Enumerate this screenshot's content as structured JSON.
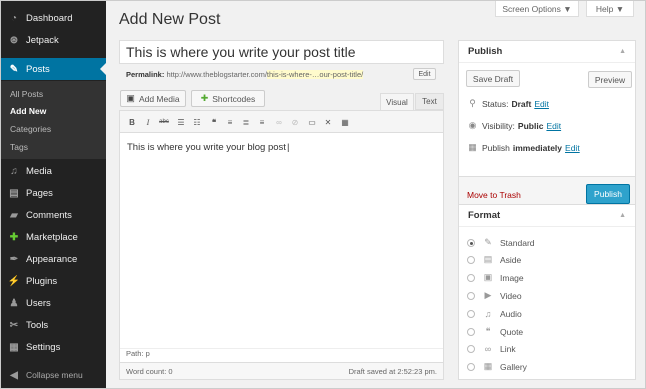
{
  "sidebar": {
    "items": [
      {
        "label": "Dashboard",
        "icon": "dashboard-icon",
        "glyph": "◔"
      },
      {
        "label": "Jetpack",
        "icon": "jetpack-icon",
        "glyph": "⊛"
      },
      {
        "label": "Posts",
        "icon": "pin-icon",
        "glyph": "✎"
      },
      {
        "label": "Media",
        "icon": "media-icon",
        "glyph": "♫"
      },
      {
        "label": "Pages",
        "icon": "pages-icon",
        "glyph": "▤"
      },
      {
        "label": "Comments",
        "icon": "comments-icon",
        "glyph": "▰"
      },
      {
        "label": "Marketplace",
        "icon": "marketplace-icon",
        "glyph": "✚"
      },
      {
        "label": "Appearance",
        "icon": "appearance-icon",
        "glyph": "✒"
      },
      {
        "label": "Plugins",
        "icon": "plugins-icon",
        "glyph": "⚡"
      },
      {
        "label": "Users",
        "icon": "users-icon",
        "glyph": "♟"
      },
      {
        "label": "Tools",
        "icon": "tools-icon",
        "glyph": "✂"
      },
      {
        "label": "Settings",
        "icon": "settings-icon",
        "glyph": "▦"
      }
    ],
    "submenu": [
      "All Posts",
      "Add New",
      "Categories",
      "Tags"
    ],
    "collapse": "Collapse menu"
  },
  "header": {
    "title": "Add New Post",
    "screen_options": "Screen Options ▼",
    "help": "Help ▼"
  },
  "post": {
    "title": "This is where you write your post title",
    "permalink_label": "Permalink:",
    "permalink_base": "http://www.theblogstarter.com/",
    "permalink_slug": "this-is-where-…our-post-title/",
    "edit_label": "Edit"
  },
  "media": {
    "add_media": "Add Media",
    "shortcodes": "Shortcodes"
  },
  "editor": {
    "tab_visual": "Visual",
    "tab_text": "Text",
    "content": "This is where you write your blog post",
    "path": "Path: p",
    "word_count": "Word count: 0",
    "draft_saved": "Draft saved at 2:52:23 pm."
  },
  "publish": {
    "heading": "Publish",
    "save_draft": "Save Draft",
    "preview": "Preview",
    "status_label": "Status:",
    "status_value": "Draft",
    "visibility_label": "Visibility:",
    "visibility_value": "Public",
    "publish_label": "Publish",
    "publish_value": "immediately",
    "edit": "Edit",
    "trash": "Move to Trash",
    "publish_button": "Publish"
  },
  "format": {
    "heading": "Format",
    "options": [
      {
        "label": "Standard",
        "icon": "pin-icon",
        "glyph": "✎",
        "selected": true
      },
      {
        "label": "Aside",
        "icon": "aside-icon",
        "glyph": "▤",
        "selected": false
      },
      {
        "label": "Image",
        "icon": "image-icon",
        "glyph": "▣",
        "selected": false
      },
      {
        "label": "Video",
        "icon": "video-icon",
        "glyph": "▶",
        "selected": false
      },
      {
        "label": "Audio",
        "icon": "audio-icon",
        "glyph": "♫",
        "selected": false
      },
      {
        "label": "Quote",
        "icon": "quote-icon",
        "glyph": "❝",
        "selected": false
      },
      {
        "label": "Link",
        "icon": "link-icon",
        "glyph": "∞",
        "selected": false
      },
      {
        "label": "Gallery",
        "icon": "gallery-icon",
        "glyph": "▦",
        "selected": false
      }
    ]
  },
  "colors": {
    "sidebar_bg": "#222222",
    "active": "#0074a2",
    "publish_button": "#2ea2cc",
    "trash": "#aa0000"
  }
}
